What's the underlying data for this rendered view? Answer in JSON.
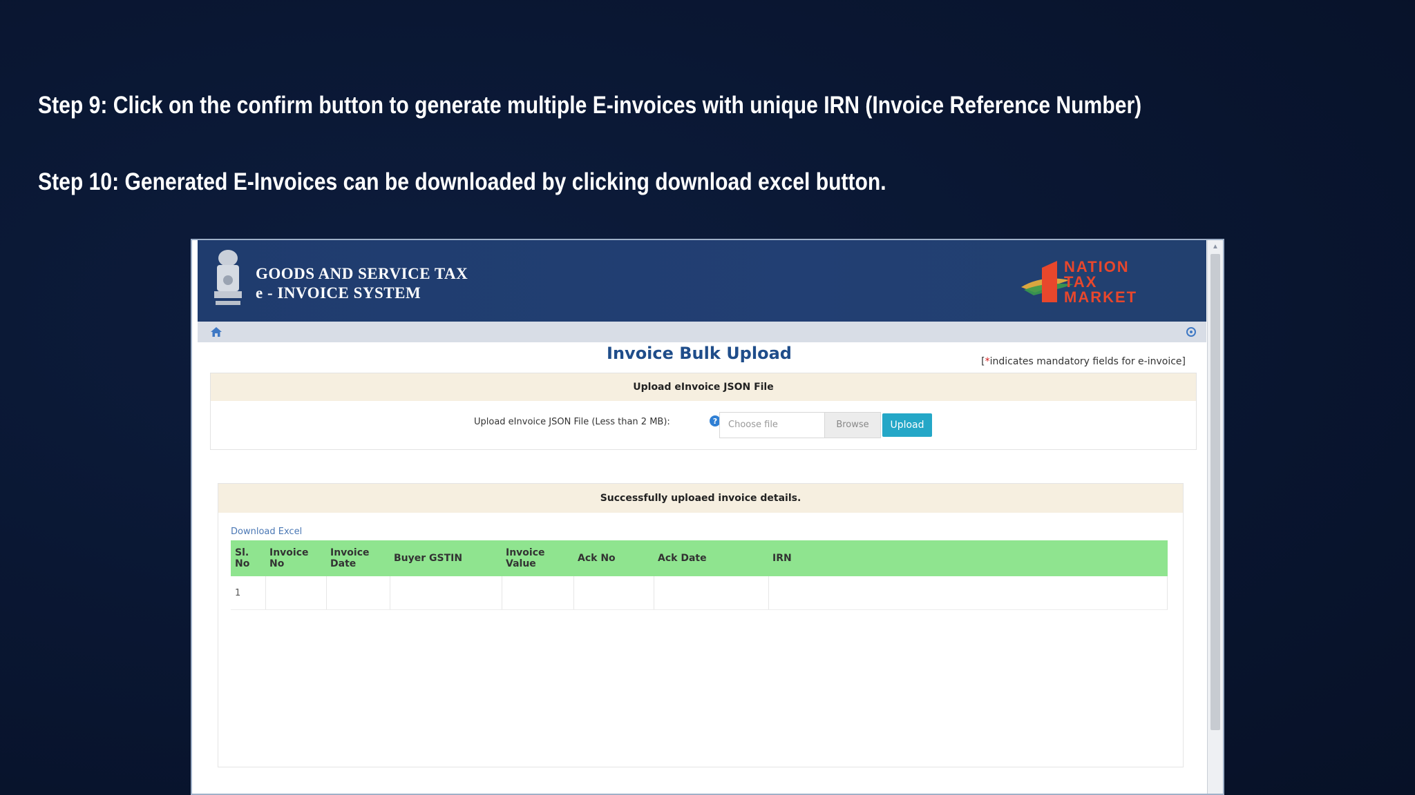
{
  "slide": {
    "step9": "Step 9: Click on the confirm button to generate multiple E-invoices with unique IRN (Invoice Reference Number)",
    "step10": "Step 10: Generated E-Invoices can be downloaded by clicking download excel button."
  },
  "portal": {
    "brand_line1": "GOODS AND SERVICE TAX",
    "brand_line2": "e - INVOICE SYSTEM",
    "logo_text": [
      "NATION",
      "TAX",
      "MARKET"
    ],
    "page_title": "Invoice Bulk Upload",
    "mandatory_star": "*",
    "mandatory_note": "indicates mandatory fields for e-invoice",
    "upload_section_title": "Upload eInvoice JSON File",
    "upload_label": "Upload eInvoice JSON File (Less than 2 MB):",
    "file_placeholder": "Choose file",
    "browse_label": "Browse",
    "upload_button": "Upload",
    "result_title": "Successfully uploaed invoice details.",
    "download_excel": "Download Excel",
    "table": {
      "columns": [
        {
          "l1": "Sl.",
          "l2": "No"
        },
        {
          "l1": "Invoice",
          "l2": "No"
        },
        {
          "l1": "Invoice",
          "l2": "Date"
        },
        {
          "l1": "Buyer GSTIN",
          "l2": ""
        },
        {
          "l1": "Invoice",
          "l2": "Value"
        },
        {
          "l1": "Ack No",
          "l2": ""
        },
        {
          "l1": "Ack Date",
          "l2": ""
        },
        {
          "l1": "IRN",
          "l2": ""
        }
      ],
      "rows": [
        [
          "1",
          "",
          "",
          "",
          "",
          "",
          "",
          ""
        ]
      ]
    },
    "colors": {
      "header_bg": "#223f73",
      "table_header_bg": "#8fe48f",
      "upload_button_bg": "#24a7c7",
      "title_color": "#1f4d8a"
    }
  }
}
